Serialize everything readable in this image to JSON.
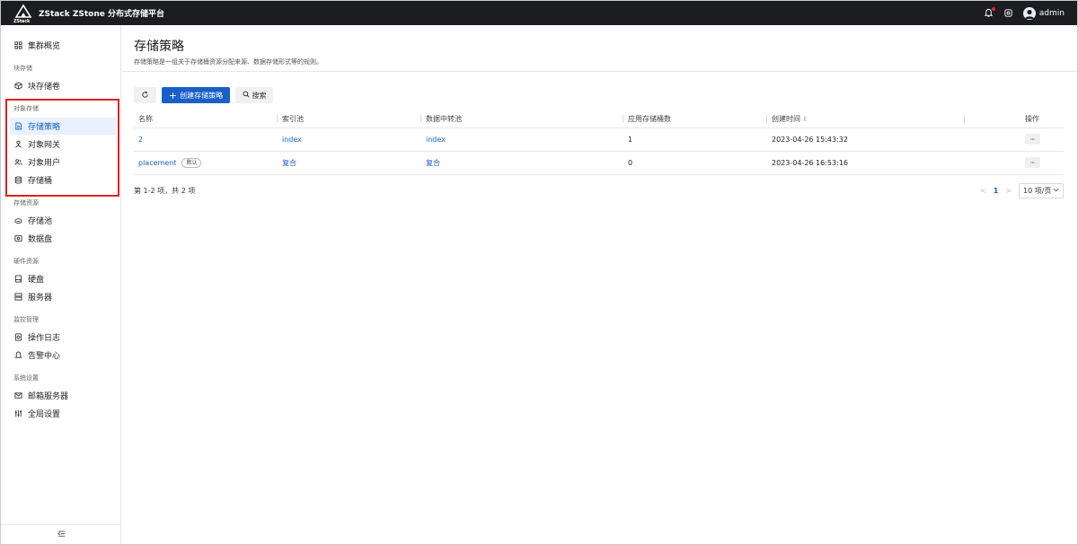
{
  "app": {
    "title": "ZStack ZStone 分布式存储平台",
    "logo_sub": "ZStack",
    "user": "admin"
  },
  "sidebar": {
    "items": [
      {
        "label": "集群概览",
        "icon": "grid-icon"
      },
      {
        "group": "块存储"
      },
      {
        "label": "块存储卷",
        "icon": "cube-icon"
      },
      {
        "group": "对象存储"
      },
      {
        "label": "存储策略",
        "icon": "doc-icon",
        "active": true
      },
      {
        "label": "对象网关",
        "icon": "gateway-icon"
      },
      {
        "label": "对象用户",
        "icon": "users-icon"
      },
      {
        "label": "存储桶",
        "icon": "bucket-icon"
      },
      {
        "group": "存储资源"
      },
      {
        "label": "存储池",
        "icon": "pool-icon"
      },
      {
        "label": "数据盘",
        "icon": "disk-icon"
      },
      {
        "group": "硬件资源"
      },
      {
        "label": "硬盘",
        "icon": "harddisk-icon"
      },
      {
        "label": "服务器",
        "icon": "server-icon"
      },
      {
        "group": "监控管理"
      },
      {
        "label": "操作日志",
        "icon": "log-icon"
      },
      {
        "label": "告警中心",
        "icon": "bell-icon"
      },
      {
        "group": "系统设置"
      },
      {
        "label": "邮箱服务器",
        "icon": "mail-icon"
      },
      {
        "label": "全局设置",
        "icon": "settings-icon"
      }
    ],
    "collapse_icon": "collapse-icon",
    "highlight_color": "#e02020"
  },
  "page": {
    "title": "存储策略",
    "description": "存储策略是一组关于存储桶资源分配来源、数据存储形式等的规则。"
  },
  "toolbar": {
    "create_label": "创建存储策略",
    "search_label": "搜索"
  },
  "table": {
    "columns": [
      "名称",
      "索引池",
      "数据中转池",
      "应用存储桶数",
      "创建时间",
      "",
      "操作"
    ],
    "rows": [
      {
        "name": "2",
        "tag": "",
        "index_pool": "index",
        "transfer_pool": "index",
        "bucket_count": "1",
        "created": "2023-04-26 15:43:32",
        "action": "···"
      },
      {
        "name": "placement",
        "tag": "默认",
        "index_pool": "复合",
        "transfer_pool": "复合",
        "bucket_count": "0",
        "created": "2023-04-26 16:53:16",
        "action": "···"
      }
    ]
  },
  "pagination": {
    "total": "第 1-2 项，共 2 项",
    "current": "1",
    "page_size": "10 项/页"
  },
  "colors": {
    "primary": "#1a5fc8",
    "topbar": "#1c1d21"
  }
}
